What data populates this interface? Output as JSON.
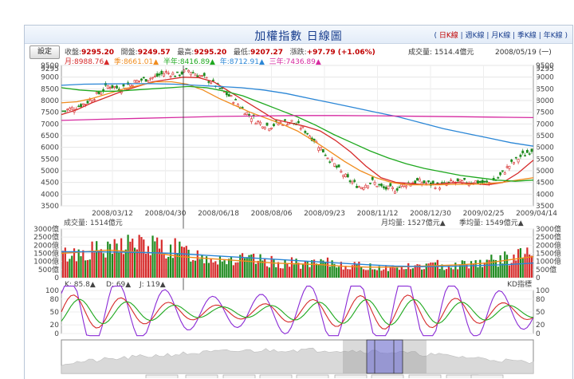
{
  "title": "加權指數 日線圖",
  "settings_label": "設定",
  "period_links": {
    "open": "(",
    "items": [
      {
        "label": "日K線",
        "active": true
      },
      {
        "label": "週K線",
        "active": false
      },
      {
        "label": "月K線",
        "active": false
      },
      {
        "label": "季K線",
        "active": false
      },
      {
        "label": "年K線",
        "active": false
      }
    ],
    "sep": "|",
    "close": ")"
  },
  "quote": {
    "close_label": "收盤:",
    "close": "9295.20",
    "open_label": "開盤:",
    "open": "9249.57",
    "high_label": "最高:",
    "high": "9295.20",
    "low_label": "最低:",
    "low": "9207.27",
    "change_label": "漲跌:",
    "change": "+97.79 (+1.06%)",
    "volume_text": "成交量: 1514.4億元",
    "date_text": "2008/05/19 (一)"
  },
  "ma_legend": [
    {
      "text": "月:8988.76▲",
      "color": "#d62a2a"
    },
    {
      "text": "季:8661.01▲",
      "color": "#f08c1e"
    },
    {
      "text": "半年:8416.89▲",
      "color": "#1ea81e"
    },
    {
      "text": "年:8712.91▲",
      "color": "#2a86d6"
    },
    {
      "text": "三年:7436.89▲",
      "color": "#d62aa0"
    }
  ],
  "chart_data": [
    {
      "type": "candlestick",
      "ylim": [
        3500,
        9500
      ],
      "yticks": [
        3500,
        4000,
        4500,
        5000,
        5500,
        6000,
        6500,
        7000,
        7500,
        8000,
        8500,
        9000,
        9500
      ],
      "cursor_value_label": "9295",
      "x_tick_labels": [
        "2008/03/12",
        "2008/04/30",
        "2008/06/18",
        "2008/08/06",
        "2008/09/23",
        "2008/11/12",
        "2008/12/30",
        "2009/02/25",
        "2009/04/14"
      ],
      "close_trend": [
        7550,
        7700,
        7900,
        8250,
        8650,
        8500,
        8750,
        8900,
        9000,
        9200,
        9100,
        9295,
        9050,
        8800,
        8400,
        8000,
        7500,
        7100,
        6900,
        7050,
        7100,
        6800,
        6300,
        5700,
        5100,
        4600,
        4300,
        4550,
        4250,
        4200,
        4450,
        4550,
        4450,
        4350,
        4500,
        4500,
        4550,
        4450,
        4650,
        5200,
        5600,
        5900
      ],
      "moving_averages": [
        {
          "name": "月",
          "color": "#d62a2a",
          "values": [
            7400,
            7600,
            7900,
            8150,
            8400,
            8600,
            8800,
            8900,
            9000,
            8980,
            8800,
            8400,
            8000,
            7600,
            7200,
            7050,
            6900,
            6700,
            6300,
            5800,
            5200,
            4700,
            4500,
            4450,
            4400,
            4450,
            4500,
            4450,
            4400,
            4500,
            4900,
            5450
          ]
        },
        {
          "name": "季",
          "color": "#f08c1e",
          "values": [
            7900,
            7950,
            8100,
            8300,
            8500,
            8650,
            8800,
            8800,
            8700,
            8450,
            8100,
            7800,
            7500,
            7250,
            7000,
            6700,
            6300,
            5850,
            5400,
            5000,
            4700,
            4500,
            4400,
            4400,
            4400,
            4420,
            4420,
            4450,
            4500,
            4600,
            4700
          ]
        },
        {
          "name": "半年",
          "color": "#1ea81e",
          "values": [
            8550,
            8450,
            8400,
            8400,
            8450,
            8500,
            8550,
            8600,
            8550,
            8400,
            8200,
            7900,
            7600,
            7300,
            6950,
            6550,
            6200,
            5850,
            5550,
            5300,
            5100,
            4950,
            4800,
            4700,
            4600,
            4550,
            4600
          ]
        },
        {
          "name": "年",
          "color": "#2a86d6",
          "values": [
            8650,
            8700,
            8710,
            8720,
            8720,
            8700,
            8650,
            8600,
            8550,
            8450,
            8300,
            8100,
            7900,
            7700,
            7500,
            7300,
            7050,
            6800,
            6600,
            6400,
            6200,
            6050
          ]
        },
        {
          "name": "三年",
          "color": "#d62aa0",
          "values": [
            7150,
            7200,
            7240,
            7280,
            7320,
            7340,
            7360,
            7360,
            7350,
            7330,
            7310,
            7290,
            7270
          ]
        }
      ]
    },
    {
      "type": "bar",
      "title": "成交量: 1514億元",
      "unit": "億",
      "ylim": [
        0,
        3000
      ],
      "yticks": [
        0,
        500,
        1000,
        1500,
        2000,
        2500,
        3000
      ],
      "legend": [
        {
          "text": "月均量: 1527億元▲",
          "color": "#f08c1e"
        },
        {
          "text": "季均量: 1549億元▲",
          "color": "#2a86d6"
        }
      ],
      "volume_trend": [
        1400,
        1500,
        1700,
        1600,
        2200,
        2000,
        1900,
        1800,
        1514,
        1300,
        1200,
        1100,
        1100,
        1000,
        900,
        900,
        800,
        900,
        800,
        700,
        650,
        600,
        650,
        700,
        800,
        750,
        900,
        1000,
        1100,
        1300,
        1600
      ],
      "month_avg": [
        1500,
        1600,
        1700,
        1600,
        1527,
        1300,
        1200,
        1100,
        1000,
        900,
        850,
        800,
        700,
        650,
        650,
        700,
        750,
        800,
        900,
        1100,
        1300
      ],
      "quarter_avg": [
        1600,
        1600,
        1580,
        1549,
        1500,
        1400,
        1300,
        1200,
        1100,
        1000,
        900,
        800,
        720,
        680,
        700,
        750,
        800,
        900
      ]
    },
    {
      "type": "line",
      "title": "KD指標",
      "ylim": [
        0,
        100
      ],
      "yticks": [
        0,
        20,
        50,
        80,
        100
      ],
      "legend": [
        {
          "text": "K: 85.8▲",
          "color": "#d62a2a"
        },
        {
          "text": "D: 69▲",
          "color": "#1ea81e"
        },
        {
          "text": "J: 119▲",
          "color": "#8a2ad6"
        }
      ]
    }
  ]
}
